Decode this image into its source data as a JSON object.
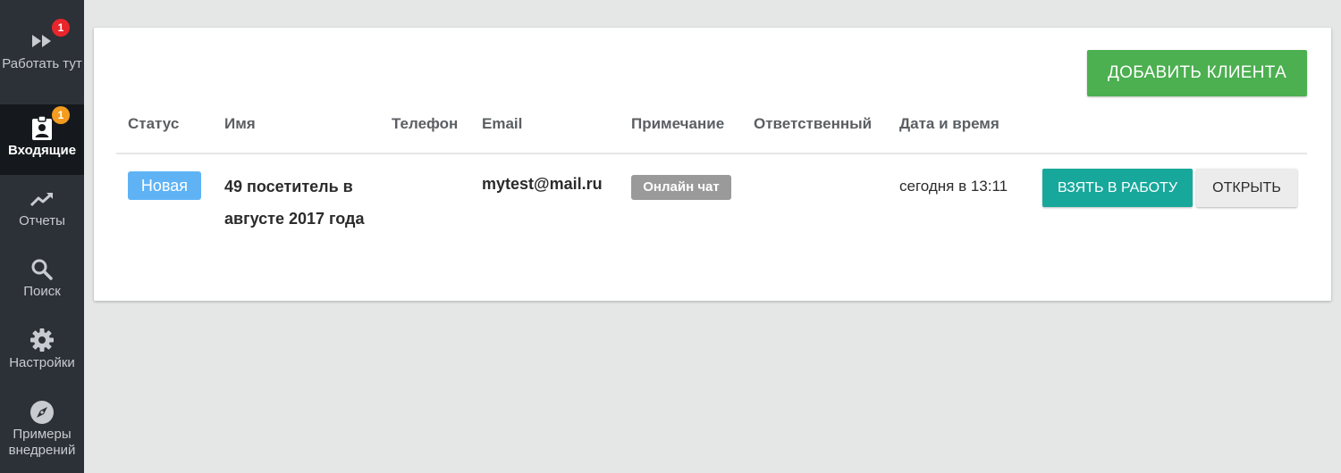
{
  "sidebar": {
    "items": [
      {
        "label": "Работать тут",
        "icon": "fast-forward-icon",
        "badge": "1"
      },
      {
        "label": "Входящие",
        "icon": "clipboard-user-icon",
        "badge": "1",
        "active": true
      },
      {
        "label": "Отчеты",
        "icon": "trending-up-icon"
      },
      {
        "label": "Поиск",
        "icon": "search-icon"
      },
      {
        "label": "Настройки",
        "icon": "gear-icon"
      },
      {
        "label": "Примеры внедрений",
        "icon": "compass-icon"
      }
    ]
  },
  "toolbar": {
    "add_client_label": "ДОБАВИТЬ КЛИЕНТА"
  },
  "table": {
    "columns": [
      "Статус",
      "Имя",
      "Телефон",
      "Email",
      "Примечание",
      "Ответственный",
      "Дата и время"
    ],
    "rows": [
      {
        "status": "Новая",
        "name": "49 посетитель в августе 2017 года",
        "phone": "",
        "email": "mytest@mail.ru",
        "note": "Онлайн чат",
        "responsible": "",
        "datetime": "сегодня в 13:11",
        "take_label": "ВЗЯТЬ В РАБОТУ",
        "open_label": "ОТКРЫТЬ"
      }
    ]
  },
  "colors": {
    "sidebar_bg": "#2c3137",
    "sidebar_active_bg": "#15191d",
    "add_button": "#4caf50",
    "take_button": "#17a89b",
    "status_new": "#5fb3f5",
    "note_badge": "#9a9a9a",
    "badge_red": "#e8262b",
    "badge_orange": "#f39c1f"
  }
}
